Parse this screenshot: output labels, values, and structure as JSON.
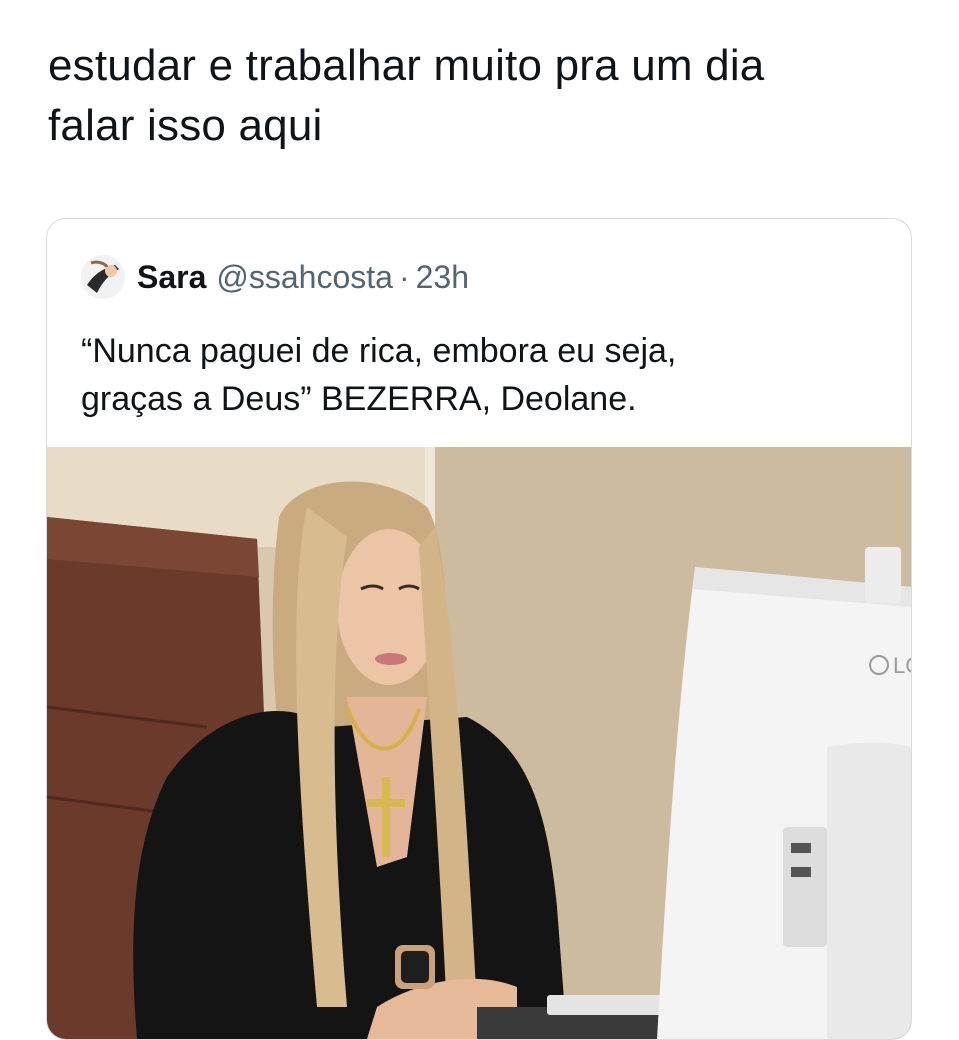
{
  "tweet": {
    "text_lines": [
      "estudar e trabalhar muito pra um dia",
      "falar isso aqui"
    ]
  },
  "quoted_tweet": {
    "author_name": "Sara",
    "author_handle": "@ssahcosta",
    "separator": "·",
    "timestamp": "23h",
    "text_lines": [
      "“Nunca paguei de rica, embora eu seja,",
      "graças a Deus” BEZERRA, Deolane."
    ],
    "photo": {
      "monitor_brand": "LG"
    }
  }
}
